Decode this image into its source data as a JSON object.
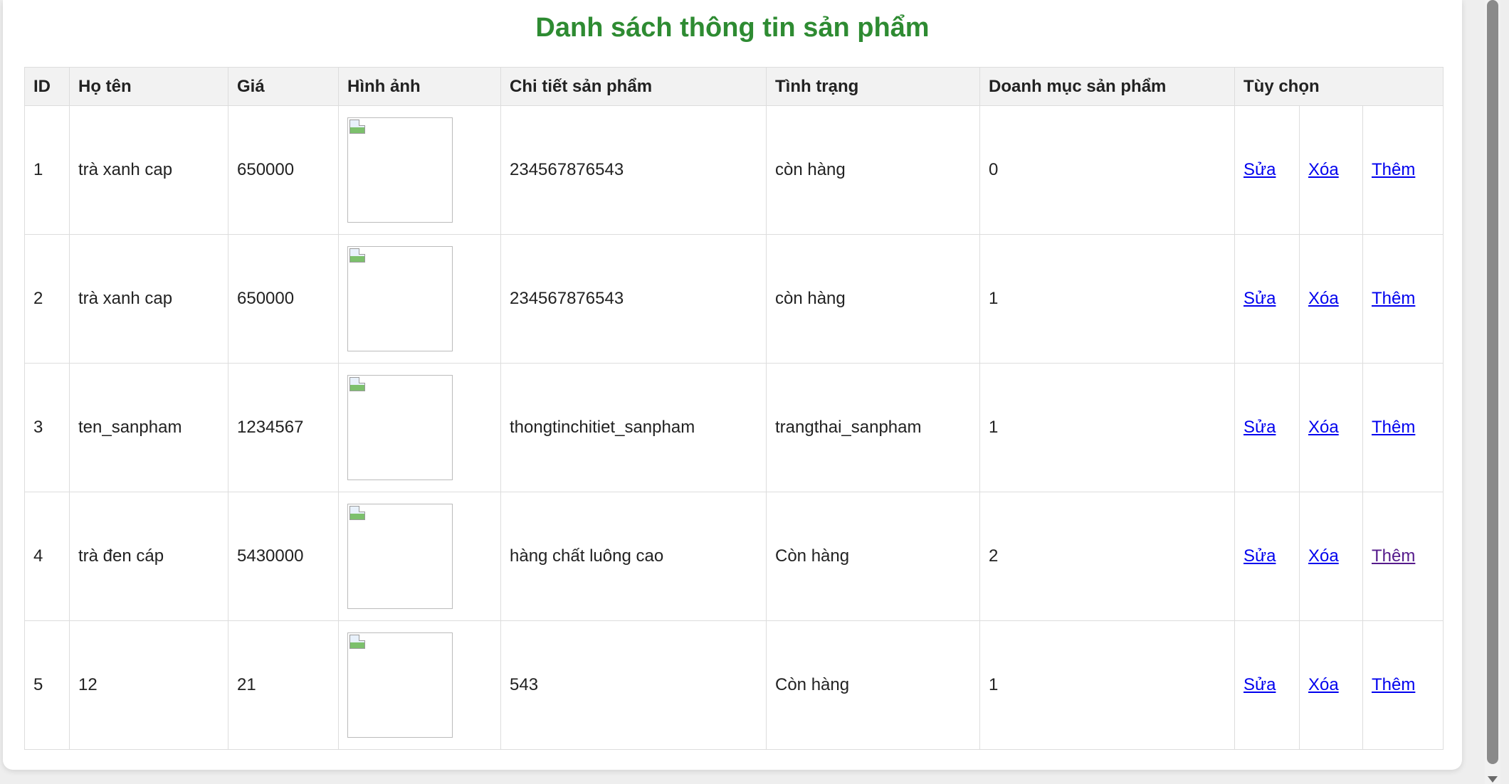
{
  "page": {
    "title": "Danh sách thông tin sản phẩm"
  },
  "table": {
    "headers": [
      "ID",
      "Họ tên",
      "Giá",
      "Hình ảnh",
      "Chi tiết sản phẩm",
      "Tình trạng",
      "Doanh mục sản phẩm",
      "Tùy chọn"
    ],
    "rows": [
      {
        "id": "1",
        "name": "trà xanh cap",
        "price": "650000",
        "detail": "234567876543",
        "status": "còn hàng",
        "category": "0"
      },
      {
        "id": "2",
        "name": "trà xanh cap",
        "price": "650000",
        "detail": "234567876543",
        "status": "còn hàng",
        "category": "1"
      },
      {
        "id": "3",
        "name": "ten_sanpham",
        "price": "1234567",
        "detail": "thongtinchitiet_sanpham",
        "status": "trangthai_sanpham",
        "category": "1"
      },
      {
        "id": "4",
        "name": "trà đen cáp",
        "price": "5430000",
        "detail": "hàng chất luông cao",
        "status": "Còn hàng",
        "category": "2"
      },
      {
        "id": "5",
        "name": "12",
        "price": "21",
        "detail": "543",
        "status": "Còn hàng",
        "category": "1"
      }
    ],
    "actions": {
      "edit": "Sửa",
      "delete": "Xóa",
      "add": "Thêm"
    }
  },
  "colors": {
    "title_green": "#2e8b32",
    "link_blue": "#0000ee",
    "link_visited": "#551a8b",
    "header_bg": "#f2f2f2",
    "border": "#dddddd"
  },
  "icons": {
    "image_placeholder": "broken-image-icon"
  }
}
